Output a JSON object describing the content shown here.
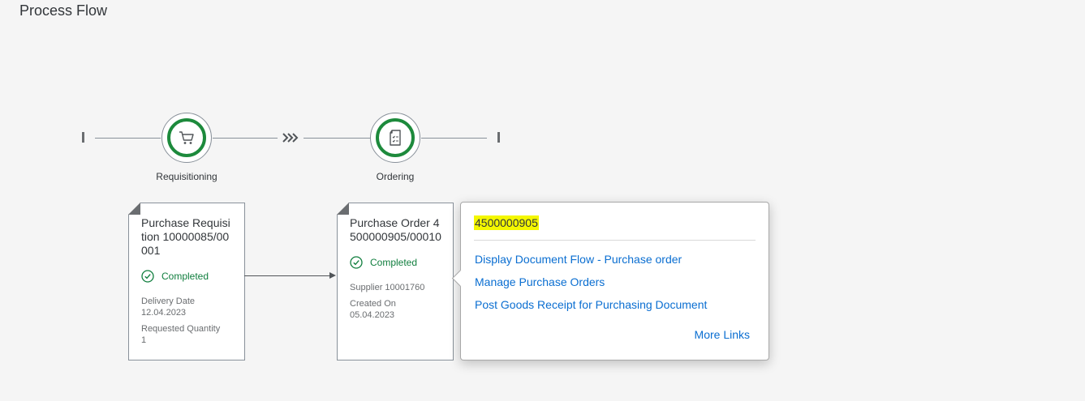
{
  "page": {
    "title": "Process Flow"
  },
  "lanes": [
    {
      "label": "Requisitioning",
      "icon": "cart-icon"
    },
    {
      "label": "Ordering",
      "icon": "document-icon"
    }
  ],
  "nodes": [
    {
      "title": "Purchase Requisition 10000085/00001",
      "status": "Completed",
      "fields": [
        {
          "label": "Delivery Date",
          "value": "12.04.2023"
        },
        {
          "label": "Requested Quantity",
          "value": "1"
        }
      ]
    },
    {
      "title": "Purchase Order 4500000905/00010",
      "status": "Completed",
      "fields": [
        {
          "label": "Supplier 10001760",
          "value": ""
        },
        {
          "label": "Created On",
          "value": "05.04.2023"
        }
      ]
    }
  ],
  "popover": {
    "title": "4500000905",
    "links": [
      "Display Document Flow - Purchase order",
      "Manage Purchase Orders",
      "Post Goods Receipt for Purchasing Document"
    ],
    "more": "More Links"
  },
  "colors": {
    "accent": "#0a6ed1",
    "success": "#107e3e",
    "highlight": "#f4f700"
  }
}
